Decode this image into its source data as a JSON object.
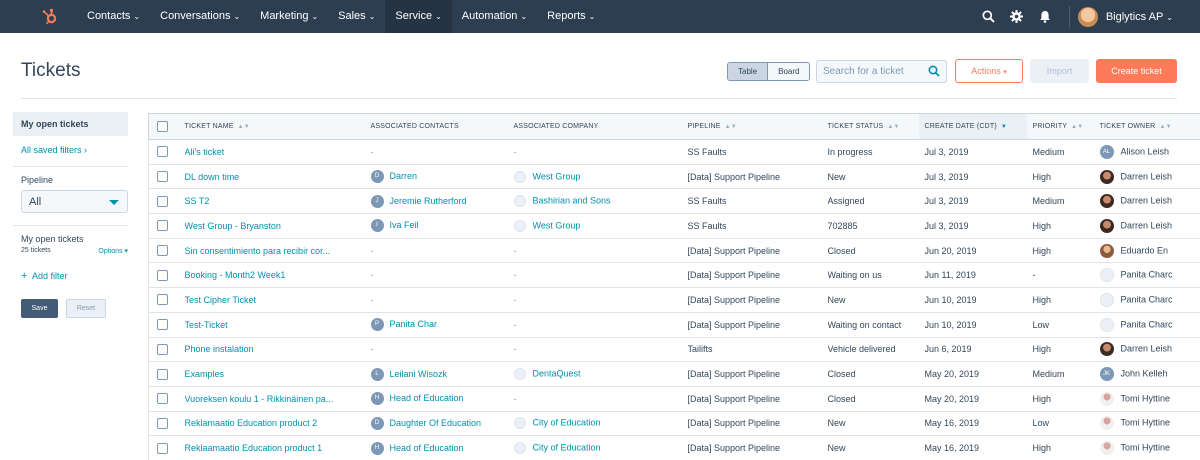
{
  "nav": {
    "items": [
      "Contacts",
      "Conversations",
      "Marketing",
      "Sales",
      "Service",
      "Automation",
      "Reports"
    ],
    "active_index": 4,
    "account_name": "Biglytics AP",
    "colors": {
      "bar": "#2d3e50",
      "logo": "#ff7a59"
    }
  },
  "header": {
    "title": "Tickets",
    "view_table": "Table",
    "view_board": "Board",
    "search_placeholder": "Search for a ticket",
    "actions": "Actions",
    "import": "Import",
    "create": "Create ticket"
  },
  "sidebar": {
    "current_view": "My open tickets",
    "all_saved": "All saved filters",
    "pipeline_label": "Pipeline",
    "pipeline_value": "All",
    "filter_name": "My open tickets",
    "count": "25 tickets",
    "options": "Options",
    "add_filter": "Add filter",
    "save": "Save",
    "reset": "Reset"
  },
  "table": {
    "columns": [
      "TICKET NAME",
      "ASSOCIATED CONTACTS",
      "ASSOCIATED COMPANY",
      "PIPELINE",
      "TICKET STATUS",
      "CREATE DATE (CDT)",
      "PRIORITY",
      "TICKET OWNER"
    ],
    "rows": [
      {
        "name": "Ali's ticket",
        "contact": "-",
        "contact_initial": "",
        "company": "-",
        "pipeline": "SS Faults",
        "status": "In progress",
        "date": "Jul 3, 2019",
        "priority": "Medium",
        "owner": "Alison Leish",
        "owner_initials": "AL",
        "owner_avatar": "initials"
      },
      {
        "name": "DL down time",
        "contact": "Darren",
        "contact_initial": "D",
        "company": "West Group",
        "pipeline": "[Data] Support Pipeline",
        "status": "New",
        "date": "Jul 3, 2019",
        "priority": "High",
        "owner": "Darren Leish",
        "owner_initials": "",
        "owner_avatar": "photo-dark"
      },
      {
        "name": "SS T2",
        "contact": "Jeremie Rutherford",
        "contact_initial": "J",
        "company": "Bashirian and Sons",
        "pipeline": "SS Faults",
        "status": "Assigned",
        "date": "Jul 3, 2019",
        "priority": "Medium",
        "owner": "Darren Leish",
        "owner_initials": "",
        "owner_avatar": "photo-dark"
      },
      {
        "name": "West Group - Bryanston",
        "contact": "Iva Feil",
        "contact_initial": "I",
        "company": "West Group",
        "pipeline": "SS Faults",
        "status": "702885",
        "date": "Jul 3, 2019",
        "priority": "High",
        "owner": "Darren Leish",
        "owner_initials": "",
        "owner_avatar": "photo-dark"
      },
      {
        "name": "Sin consentimiento para recibir cor...",
        "contact": "-",
        "contact_initial": "",
        "company": "-",
        "pipeline": "[Data] Support Pipeline",
        "status": "Closed",
        "date": "Jun 20, 2019",
        "priority": "High",
        "owner": "Eduardo En",
        "owner_initials": "",
        "owner_avatar": "photo-light"
      },
      {
        "name": "Booking - Month2 Week1",
        "contact": "-",
        "contact_initial": "",
        "company": "-",
        "pipeline": "[Data] Support Pipeline",
        "status": "Waiting on us",
        "date": "Jun 11, 2019",
        "priority": "-",
        "owner": "Panita Charc",
        "owner_initials": "",
        "owner_avatar": "blank"
      },
      {
        "name": "Test Cipher Ticket",
        "contact": "-",
        "contact_initial": "",
        "company": "-",
        "pipeline": "[Data] Support Pipeline",
        "status": "New",
        "date": "Jun 10, 2019",
        "priority": "High",
        "owner": "Panita Charc",
        "owner_initials": "",
        "owner_avatar": "blank"
      },
      {
        "name": "Test-Ticket",
        "contact": "Panita Char",
        "contact_initial": "P",
        "company": "-",
        "pipeline": "[Data] Support Pipeline",
        "status": "Waiting on contact",
        "date": "Jun 10, 2019",
        "priority": "Low",
        "owner": "Panita Charc",
        "owner_initials": "",
        "owner_avatar": "blank"
      },
      {
        "name": "Phone instalation",
        "contact": "-",
        "contact_initial": "",
        "company": "-",
        "pipeline": "Tailifts",
        "status": "Vehicle delivered",
        "date": "Jun 6, 2019",
        "priority": "High",
        "owner": "Darren Leish",
        "owner_initials": "",
        "owner_avatar": "photo-dark"
      },
      {
        "name": "Examples",
        "contact": "Leilani Wisozk",
        "contact_initial": "L",
        "company": "DentaQuest",
        "pipeline": "[Data] Support Pipeline",
        "status": "Closed",
        "date": "May 20, 2019",
        "priority": "Medium",
        "owner": "John Kelleh",
        "owner_initials": "JK",
        "owner_avatar": "initials"
      },
      {
        "name": "Vuoreksen koulu 1 - Rikkinäinen pa...",
        "contact": "Head of Education",
        "contact_initial": "H",
        "company": "-",
        "pipeline": "[Data] Support Pipeline",
        "status": "Closed",
        "date": "May 20, 2019",
        "priority": "High",
        "owner": "Tomi Hyttine",
        "owner_initials": "",
        "owner_avatar": "photo-tomi"
      },
      {
        "name": "Reklamaatio Education product 2",
        "contact": "Daughter Of Education",
        "contact_initial": "D",
        "company": "City of Education",
        "pipeline": "[Data] Support Pipeline",
        "status": "New",
        "date": "May 16, 2019",
        "priority": "Low",
        "owner": "Tomi Hyttine",
        "owner_initials": "",
        "owner_avatar": "photo-tomi"
      },
      {
        "name": "Reklaamaatio Education product 1",
        "contact": "Head of Education",
        "contact_initial": "H",
        "company": "City of Education",
        "pipeline": "[Data] Support Pipeline",
        "status": "New",
        "date": "May 16, 2019",
        "priority": "High",
        "owner": "Tomi Hyttine",
        "owner_initials": "",
        "owner_avatar": "photo-tomi"
      }
    ]
  }
}
